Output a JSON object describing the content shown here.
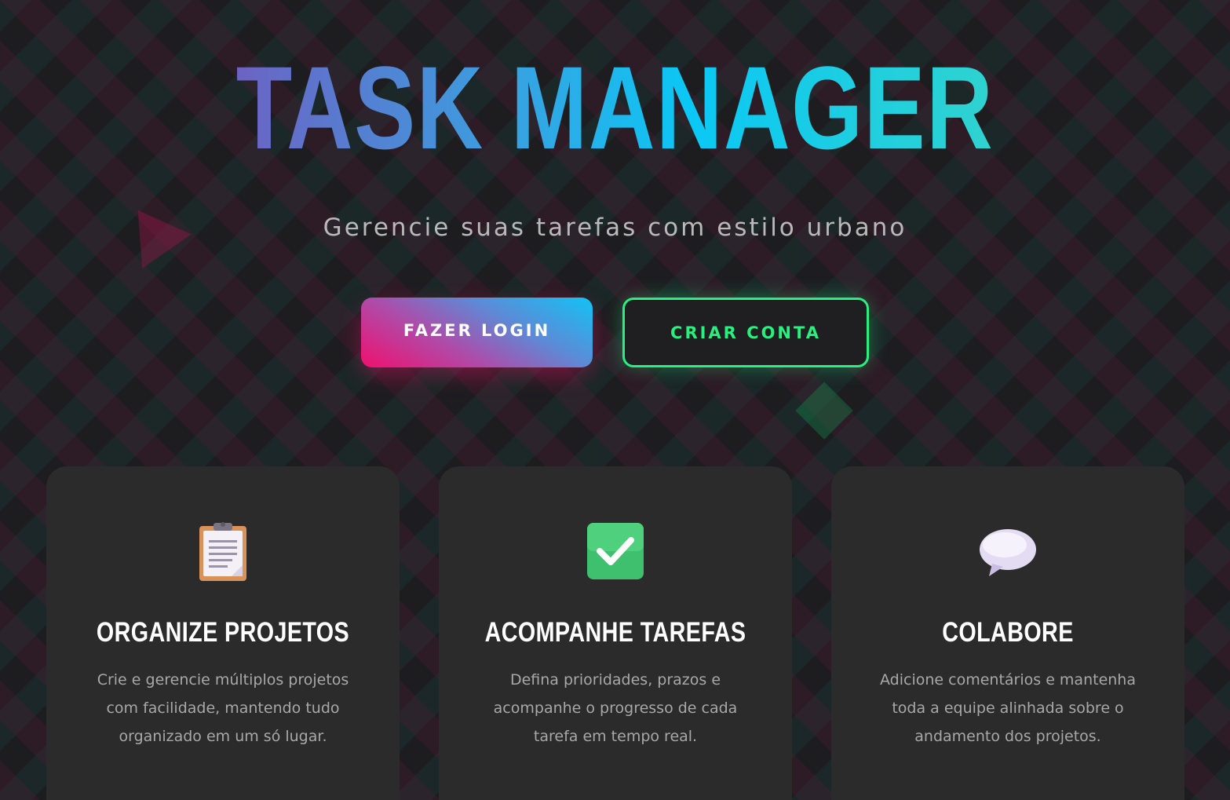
{
  "hero": {
    "title": "TASK MANAGER",
    "subtitle": "Gerencie suas tarefas com estilo urbano"
  },
  "actions": {
    "login_label": "FAZER LOGIN",
    "signup_label": "CRIAR CONTA"
  },
  "colors": {
    "accent_pink": "#f0106e",
    "accent_cyan": "#0ac8f5",
    "accent_green": "#27f07f",
    "card_bg": "#2b2b2b"
  },
  "features": [
    {
      "icon": "clipboard-icon",
      "title": "ORGANIZE PROJETOS",
      "text": "Crie e gerencie múltiplos projetos com facilidade, mantendo tudo organizado em um só lugar."
    },
    {
      "icon": "check-mark-icon",
      "title": "ACOMPANHE TAREFAS",
      "text": "Defina prioridades, prazos e acompanhe o progresso de cada tarefa em tempo real."
    },
    {
      "icon": "speech-bubble-icon",
      "title": "COLABORE",
      "text": "Adicione comentários e mantenha toda a equipe alinhada sobre o andamento dos projetos."
    }
  ]
}
